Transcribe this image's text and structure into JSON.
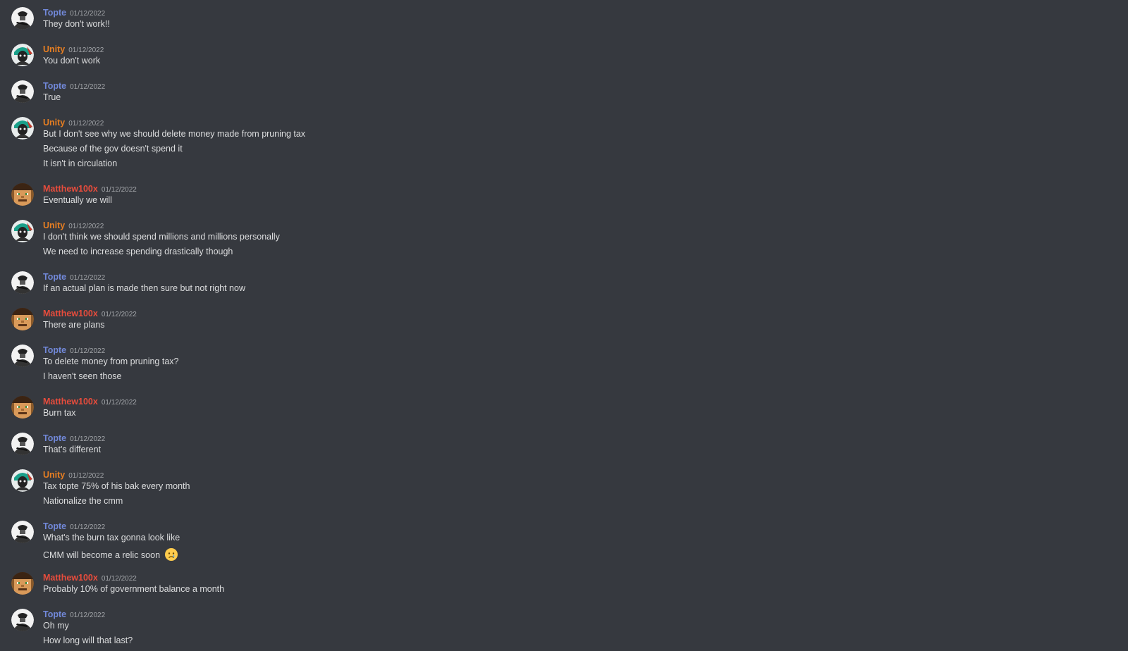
{
  "users": {
    "topte": {
      "name": "Topte",
      "color": "#7289da"
    },
    "unity": {
      "name": "Unity",
      "color": "#e67e22"
    },
    "matthew": {
      "name": "Matthew100x",
      "color": "#e74c3c"
    }
  },
  "messages": [
    {
      "author": "Topte",
      "timestamp": "01/12/2022",
      "lines": [
        "They don't work!!"
      ]
    },
    {
      "author": "Unity",
      "timestamp": "01/12/2022",
      "lines": [
        "You don't work"
      ]
    },
    {
      "author": "Topte",
      "timestamp": "01/12/2022",
      "lines": [
        "True"
      ]
    },
    {
      "author": "Unity",
      "timestamp": "01/12/2022",
      "lines": [
        "But I don't see why we should delete money made from pruning tax",
        "Because of the gov doesn't spend it",
        "It isn't in circulation"
      ]
    },
    {
      "author": "Matthew100x",
      "timestamp": "01/12/2022",
      "lines": [
        "Eventually we will"
      ]
    },
    {
      "author": "Unity",
      "timestamp": "01/12/2022",
      "lines": [
        "I don't think we should spend millions and millions personally",
        "We need to increase spending drastically though"
      ]
    },
    {
      "author": "Topte",
      "timestamp": "01/12/2022",
      "lines": [
        "If an actual plan is made then sure but not right now"
      ]
    },
    {
      "author": "Matthew100x",
      "timestamp": "01/12/2022",
      "lines": [
        "There are plans"
      ]
    },
    {
      "author": "Topte",
      "timestamp": "01/12/2022",
      "lines": [
        "To delete money from pruning tax?",
        "I haven't seen those"
      ]
    },
    {
      "author": "Matthew100x",
      "timestamp": "01/12/2022",
      "lines": [
        "Burn tax"
      ]
    },
    {
      "author": "Topte",
      "timestamp": "01/12/2022",
      "lines": [
        "That's different"
      ]
    },
    {
      "author": "Unity",
      "timestamp": "01/12/2022",
      "lines": [
        "Tax topte 75% of his bak every month",
        "Nationalize the cmm"
      ]
    },
    {
      "author": "Topte",
      "timestamp": "01/12/2022",
      "lines": [
        "What's the burn tax gonna look like",
        "CMM will become a relic soon"
      ]
    },
    {
      "author": "Matthew100x",
      "timestamp": "01/12/2022",
      "lines": [
        "Probably 10% of government balance a month"
      ]
    },
    {
      "author": "Topte",
      "timestamp": "01/12/2022",
      "lines": [
        "Oh my",
        "How long will that last?"
      ]
    }
  ],
  "emoji": {
    "name": "crying-face-icon"
  }
}
